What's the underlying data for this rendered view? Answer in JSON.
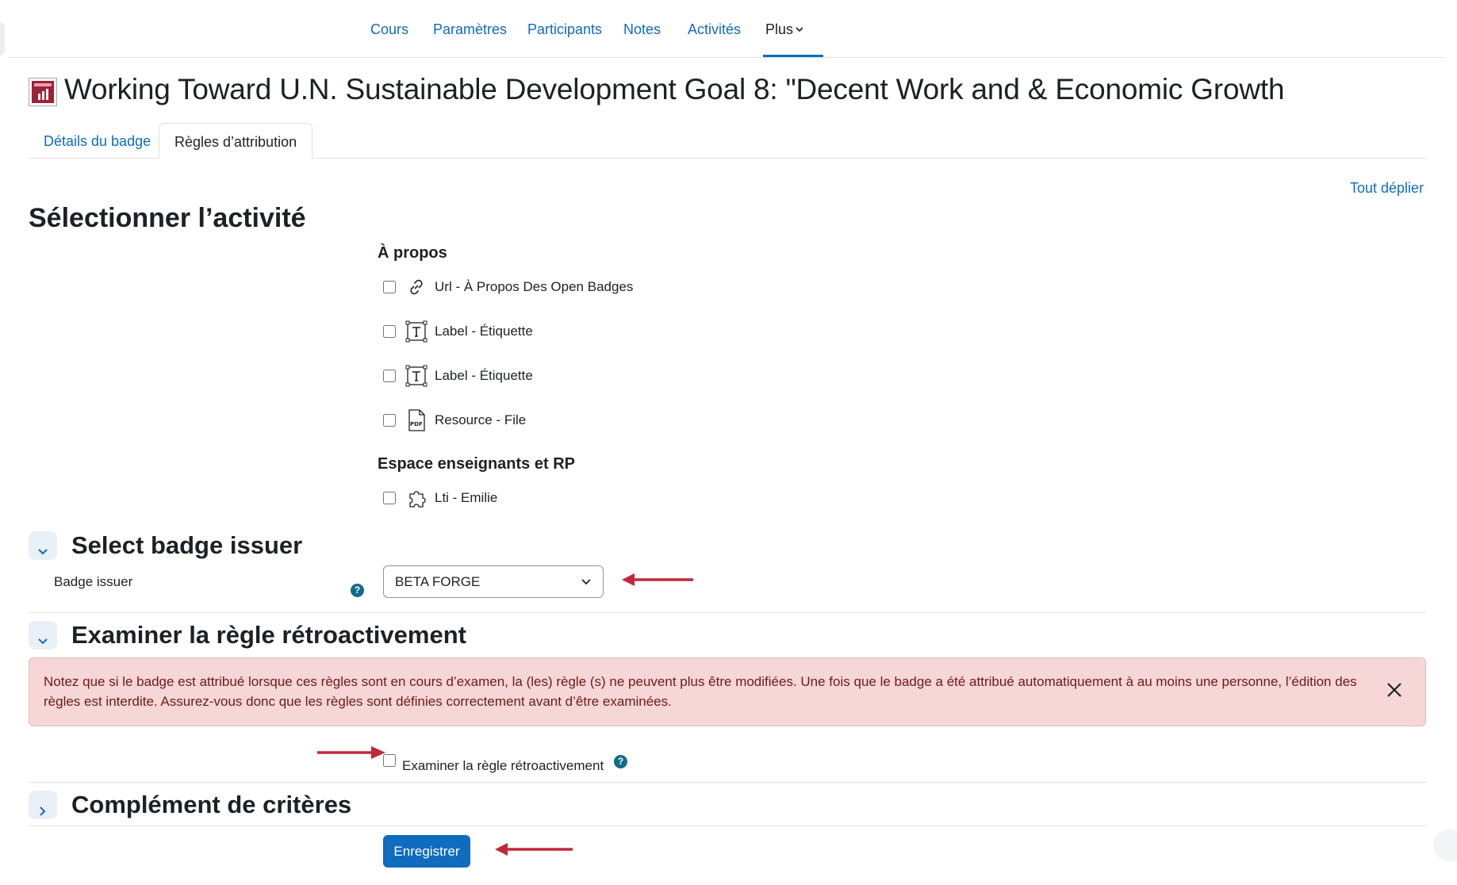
{
  "topnav": {
    "items": [
      {
        "label": "Cours"
      },
      {
        "label": "Paramètres"
      },
      {
        "label": "Participants"
      },
      {
        "label": "Notes"
      },
      {
        "label": "Activités"
      },
      {
        "label": "Plus"
      }
    ],
    "active_index": 5
  },
  "header": {
    "title": "Working Toward U.N. Sustainable Development Goal 8: \"Decent Work and & Economic Growth",
    "badge_icon": "sdg-badge-icon"
  },
  "tabs": [
    {
      "label": "Détails du badge",
      "active": false
    },
    {
      "label": "Règles d’attribution",
      "active": true
    }
  ],
  "expand_all_label": "Tout déplier",
  "select_activity": {
    "heading": "Sélectionner l’activité",
    "groups": [
      {
        "name": "À propos",
        "items": [
          {
            "label": "Url - À Propos Des Open Badges",
            "icon": "link-icon",
            "checked": false
          },
          {
            "label": "Label - Étiquette",
            "icon": "text-label-icon",
            "checked": false
          },
          {
            "label": "Label - Étiquette",
            "icon": "text-label-icon",
            "checked": false
          },
          {
            "label": "Resource - File",
            "icon": "pdf-file-icon",
            "checked": false
          }
        ]
      },
      {
        "name": "Espace enseignants et RP",
        "items": [
          {
            "label": "Lti - Emilie",
            "icon": "puzzle-icon",
            "checked": false
          }
        ]
      }
    ]
  },
  "badge_issuer": {
    "section_title": "Select badge issuer",
    "field_label": "Badge issuer",
    "selected": "BETA FORGE"
  },
  "retroactive": {
    "section_title": "Examiner la règle rétroactivement",
    "alert_text": "Notez que si le badge est attribué lorsque ces règles sont en cours d’examen, la (les) règle (s) ne peuvent plus être modifiées. Une fois que le badge a été attribué automatiquement à au moins une personne, l’édition des règles est interdite. Assurez-vous donc que les règles sont définies correctement avant d’être examinées.",
    "checkbox_label": "Examiner la règle rétroactivement",
    "checked": false
  },
  "criteria_complement": {
    "section_title": "Complément de critères"
  },
  "save_label": "Enregistrer",
  "colors": {
    "link": "#0f6cbf",
    "primary_button": "#0f6cbf",
    "alert_bg": "#f6d6d6",
    "annotation_arrow": "#c0283a",
    "help_icon": "#0f6c8a"
  }
}
